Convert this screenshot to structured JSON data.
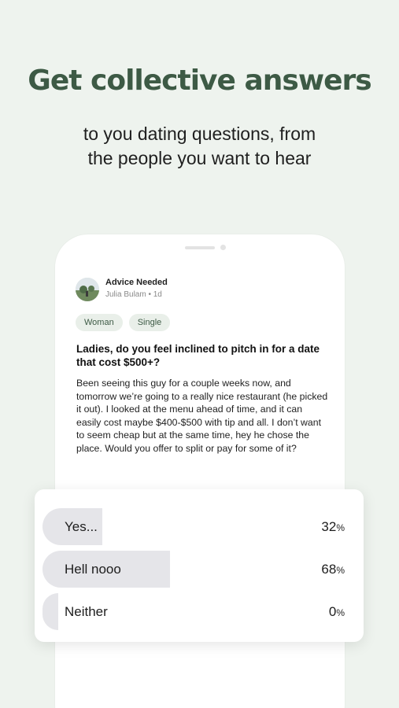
{
  "hero": {
    "title": "Get collective answers",
    "subtitle_line1": "to you dating questions, from",
    "subtitle_line2": "the people you want to hear"
  },
  "post": {
    "category": "Advice Needed",
    "meta": "Julia Bulam • 1d",
    "tags": [
      "Woman",
      "Single"
    ],
    "question": "Ladies, do you feel inclined to pitch in for a date that cost $500+?",
    "body": "Been seeing this guy for a couple weeks now, and tomorrow we’re going to a really nice restaurant (he picked it out). I looked at the menu ahead of time, and it can easily cost maybe $400-$500 with tip and all. I don’t want to seem cheap but at the same time, hey he chose the place. Would you offer to split or pay for some of it?"
  },
  "poll": {
    "options": [
      {
        "label": "Yes...",
        "percent": 32,
        "percent_text": "32",
        "unit": "%"
      },
      {
        "label": "Hell nooo",
        "percent": 68,
        "percent_text": "68",
        "unit": "%"
      },
      {
        "label": "Neither",
        "percent": 0,
        "percent_text": "0",
        "unit": "%"
      }
    ]
  },
  "colors": {
    "background": "#eef3ee",
    "brand_green": "#3d5a45",
    "tag_background": "#e9efe9",
    "poll_fill": "#e5e5e9"
  }
}
